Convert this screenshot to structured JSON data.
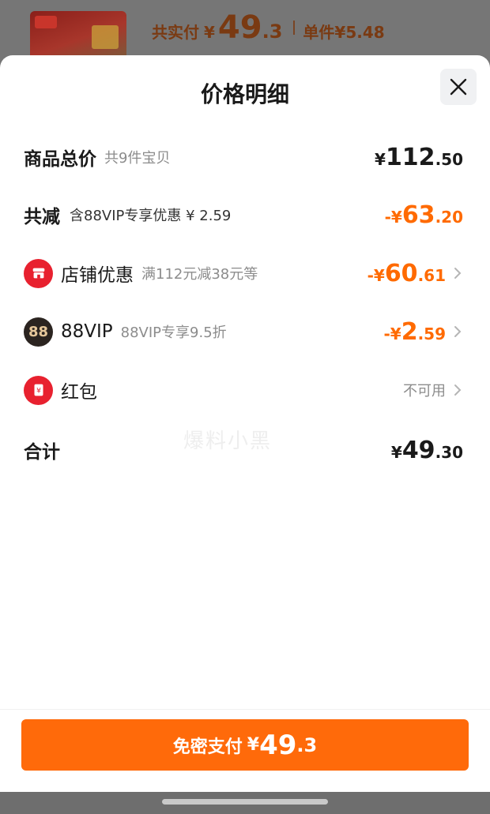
{
  "top": {
    "total_label": "共实付",
    "currency": "¥",
    "price_int": "49",
    "price_dec": ".3",
    "unit_label": "单件",
    "unit_price": "¥5.48"
  },
  "sheet": {
    "title": "价格明细"
  },
  "rows": {
    "goods": {
      "label": "商品总价",
      "sub": "共9件宝贝",
      "cur": "¥",
      "int": "112",
      "dec": ".50"
    },
    "reduce": {
      "label": "共减",
      "sub": "含88VIP专享优惠 ¥ 2.59",
      "cur": "-¥",
      "int": "63",
      "dec": ".20"
    },
    "shop": {
      "label": "店铺优惠",
      "sub": "满112元减38元等",
      "cur": "-¥",
      "int": "60",
      "dec": ".61"
    },
    "vip": {
      "label": "88VIP",
      "sub": "88VIP专享9.5折",
      "icon_text": "88",
      "cur": "-¥",
      "int": "2",
      "dec": ".59"
    },
    "redpacket": {
      "label": "红包",
      "value": "不可用",
      "icon_text": "¥"
    },
    "total": {
      "label": "合计",
      "cur": "¥",
      "int": "49",
      "dec": ".30"
    }
  },
  "watermark": "爆料小黑",
  "pay_button": {
    "label": "免密支付",
    "cur": "¥",
    "int": "49",
    "dec": ".3"
  },
  "colors": {
    "accent": "#ff6a0a",
    "discount": "#ff6a00",
    "red_icon": "#e8212f"
  }
}
